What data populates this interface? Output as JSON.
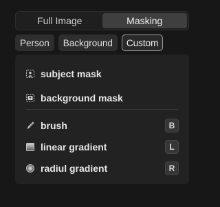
{
  "tabs": [
    {
      "label": "Full Image",
      "active": false
    },
    {
      "label": "Masking",
      "active": true
    }
  ],
  "chips": [
    {
      "label": "Person",
      "active": false
    },
    {
      "label": "Background",
      "active": false
    },
    {
      "label": "Custom",
      "active": true
    }
  ],
  "masks": [
    {
      "label": "subject mask",
      "icon": "subject-mask-icon"
    },
    {
      "label": "background mask",
      "icon": "background-mask-icon"
    }
  ],
  "tools": [
    {
      "label": "brush",
      "icon": "brush-icon",
      "key": "B"
    },
    {
      "label": "linear gradient",
      "icon": "linear-gradient-icon",
      "key": "L"
    },
    {
      "label": "radiul gradient",
      "icon": "radial-gradient-icon",
      "key": "R"
    }
  ]
}
